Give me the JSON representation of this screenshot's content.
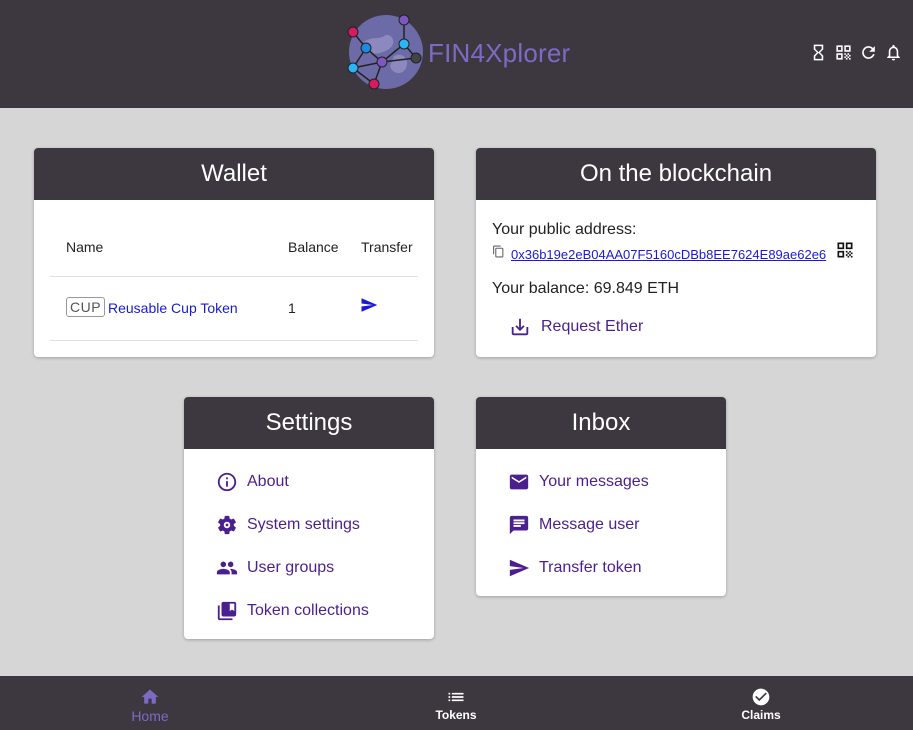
{
  "header": {
    "brand": "FIN4Xplorer",
    "icons": [
      "hourglass-icon",
      "qr-code-icon",
      "refresh-icon",
      "bell-icon"
    ]
  },
  "wallet": {
    "title": "Wallet",
    "columns": [
      "Name",
      "Balance",
      "Transfer"
    ],
    "tokens": [
      {
        "symbol": "CUP",
        "name": "Reusable Cup Token",
        "balance": "1"
      }
    ]
  },
  "chain": {
    "title": "On the blockchain",
    "address_label": "Your public address:",
    "address": "0x36b19e2eB04AA07F5160cDBb8EE7624E89ae62e6",
    "balance": "Your balance: 69.849 ETH",
    "request_label": "Request Ether"
  },
  "settings": {
    "title": "Settings",
    "items": [
      {
        "label": "About",
        "icon": "info-icon"
      },
      {
        "label": "System settings",
        "icon": "gear-icon"
      },
      {
        "label": "User groups",
        "icon": "people-icon"
      },
      {
        "label": "Token collections",
        "icon": "collections-icon"
      }
    ]
  },
  "inbox": {
    "title": "Inbox",
    "items": [
      {
        "label": "Your messages",
        "icon": "mail-icon"
      },
      {
        "label": "Message user",
        "icon": "chat-icon"
      },
      {
        "label": "Transfer token",
        "icon": "send-icon"
      }
    ]
  },
  "bottom_nav": {
    "items": [
      {
        "label": "Home",
        "icon": "home-icon",
        "active": true
      },
      {
        "label": "Tokens",
        "icon": "list-icon",
        "active": false
      },
      {
        "label": "Claims",
        "icon": "check-circle-icon",
        "active": false
      }
    ]
  },
  "colors": {
    "bar": "#3d3840",
    "accent": "#7b6bc4",
    "link": "#1a1ad6",
    "menu": "#4b1f8f",
    "background": "#d6d6d6"
  }
}
